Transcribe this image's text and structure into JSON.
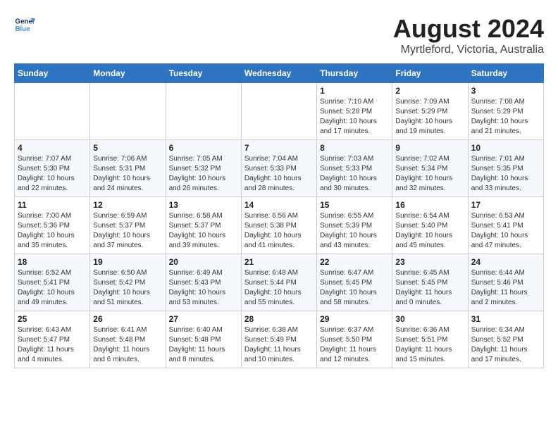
{
  "logo": {
    "line1": "General",
    "line2": "Blue"
  },
  "title": "August 2024",
  "subtitle": "Myrtleford, Victoria, Australia",
  "days_of_week": [
    "Sunday",
    "Monday",
    "Tuesday",
    "Wednesday",
    "Thursday",
    "Friday",
    "Saturday"
  ],
  "weeks": [
    [
      {
        "day": "",
        "info": ""
      },
      {
        "day": "",
        "info": ""
      },
      {
        "day": "",
        "info": ""
      },
      {
        "day": "",
        "info": ""
      },
      {
        "day": "1",
        "info": "Sunrise: 7:10 AM\nSunset: 5:28 PM\nDaylight: 10 hours\nand 17 minutes."
      },
      {
        "day": "2",
        "info": "Sunrise: 7:09 AM\nSunset: 5:29 PM\nDaylight: 10 hours\nand 19 minutes."
      },
      {
        "day": "3",
        "info": "Sunrise: 7:08 AM\nSunset: 5:29 PM\nDaylight: 10 hours\nand 21 minutes."
      }
    ],
    [
      {
        "day": "4",
        "info": "Sunrise: 7:07 AM\nSunset: 5:30 PM\nDaylight: 10 hours\nand 22 minutes."
      },
      {
        "day": "5",
        "info": "Sunrise: 7:06 AM\nSunset: 5:31 PM\nDaylight: 10 hours\nand 24 minutes."
      },
      {
        "day": "6",
        "info": "Sunrise: 7:05 AM\nSunset: 5:32 PM\nDaylight: 10 hours\nand 26 minutes."
      },
      {
        "day": "7",
        "info": "Sunrise: 7:04 AM\nSunset: 5:33 PM\nDaylight: 10 hours\nand 28 minutes."
      },
      {
        "day": "8",
        "info": "Sunrise: 7:03 AM\nSunset: 5:33 PM\nDaylight: 10 hours\nand 30 minutes."
      },
      {
        "day": "9",
        "info": "Sunrise: 7:02 AM\nSunset: 5:34 PM\nDaylight: 10 hours\nand 32 minutes."
      },
      {
        "day": "10",
        "info": "Sunrise: 7:01 AM\nSunset: 5:35 PM\nDaylight: 10 hours\nand 33 minutes."
      }
    ],
    [
      {
        "day": "11",
        "info": "Sunrise: 7:00 AM\nSunset: 5:36 PM\nDaylight: 10 hours\nand 35 minutes."
      },
      {
        "day": "12",
        "info": "Sunrise: 6:59 AM\nSunset: 5:37 PM\nDaylight: 10 hours\nand 37 minutes."
      },
      {
        "day": "13",
        "info": "Sunrise: 6:58 AM\nSunset: 5:37 PM\nDaylight: 10 hours\nand 39 minutes."
      },
      {
        "day": "14",
        "info": "Sunrise: 6:56 AM\nSunset: 5:38 PM\nDaylight: 10 hours\nand 41 minutes."
      },
      {
        "day": "15",
        "info": "Sunrise: 6:55 AM\nSunset: 5:39 PM\nDaylight: 10 hours\nand 43 minutes."
      },
      {
        "day": "16",
        "info": "Sunrise: 6:54 AM\nSunset: 5:40 PM\nDaylight: 10 hours\nand 45 minutes."
      },
      {
        "day": "17",
        "info": "Sunrise: 6:53 AM\nSunset: 5:41 PM\nDaylight: 10 hours\nand 47 minutes."
      }
    ],
    [
      {
        "day": "18",
        "info": "Sunrise: 6:52 AM\nSunset: 5:41 PM\nDaylight: 10 hours\nand 49 minutes."
      },
      {
        "day": "19",
        "info": "Sunrise: 6:50 AM\nSunset: 5:42 PM\nDaylight: 10 hours\nand 51 minutes."
      },
      {
        "day": "20",
        "info": "Sunrise: 6:49 AM\nSunset: 5:43 PM\nDaylight: 10 hours\nand 53 minutes."
      },
      {
        "day": "21",
        "info": "Sunrise: 6:48 AM\nSunset: 5:44 PM\nDaylight: 10 hours\nand 55 minutes."
      },
      {
        "day": "22",
        "info": "Sunrise: 6:47 AM\nSunset: 5:45 PM\nDaylight: 10 hours\nand 58 minutes."
      },
      {
        "day": "23",
        "info": "Sunrise: 6:45 AM\nSunset: 5:45 PM\nDaylight: 11 hours\nand 0 minutes."
      },
      {
        "day": "24",
        "info": "Sunrise: 6:44 AM\nSunset: 5:46 PM\nDaylight: 11 hours\nand 2 minutes."
      }
    ],
    [
      {
        "day": "25",
        "info": "Sunrise: 6:43 AM\nSunset: 5:47 PM\nDaylight: 11 hours\nand 4 minutes."
      },
      {
        "day": "26",
        "info": "Sunrise: 6:41 AM\nSunset: 5:48 PM\nDaylight: 11 hours\nand 6 minutes."
      },
      {
        "day": "27",
        "info": "Sunrise: 6:40 AM\nSunset: 5:48 PM\nDaylight: 11 hours\nand 8 minutes."
      },
      {
        "day": "28",
        "info": "Sunrise: 6:38 AM\nSunset: 5:49 PM\nDaylight: 11 hours\nand 10 minutes."
      },
      {
        "day": "29",
        "info": "Sunrise: 6:37 AM\nSunset: 5:50 PM\nDaylight: 11 hours\nand 12 minutes."
      },
      {
        "day": "30",
        "info": "Sunrise: 6:36 AM\nSunset: 5:51 PM\nDaylight: 11 hours\nand 15 minutes."
      },
      {
        "day": "31",
        "info": "Sunrise: 6:34 AM\nSunset: 5:52 PM\nDaylight: 11 hours\nand 17 minutes."
      }
    ]
  ]
}
